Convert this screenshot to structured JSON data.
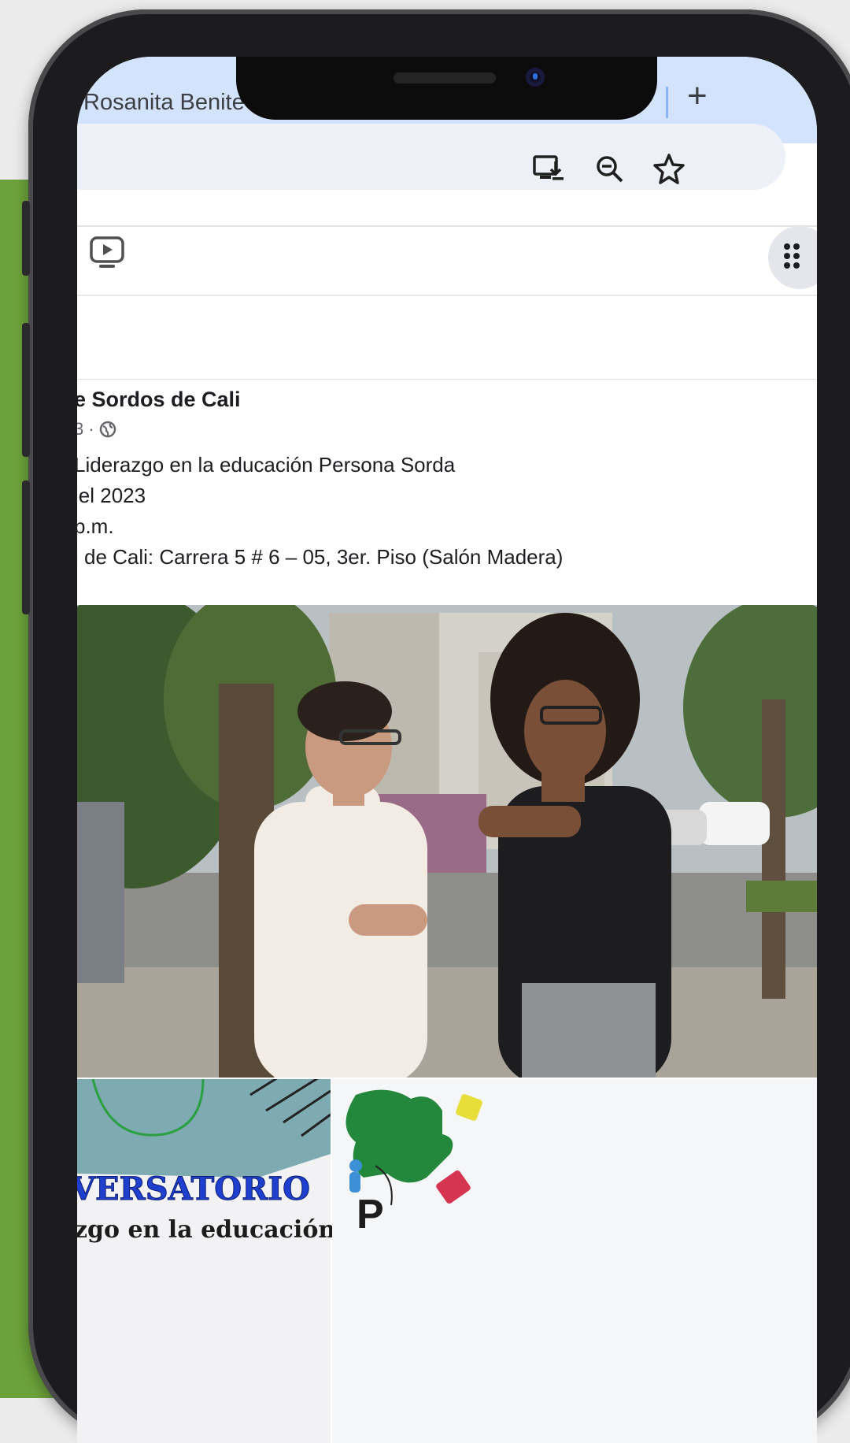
{
  "browser": {
    "tab_title": "Rosanita Benite",
    "new_tab": "+",
    "toolbar_icons": [
      "install-app-icon",
      "zoom-out-icon",
      "bookmark-star-icon"
    ]
  },
  "facebook_nav": {
    "icons": [
      "video-icon",
      "menu-grid-icon"
    ]
  },
  "post": {
    "author": "e Sordos de Cali",
    "meta": "3 ·",
    "lines": [
      "Liderazgo en la educación Persona Sorda",
      "lel 2023",
      "p.m.",
      "l de Cali: Carrera 5 # 6 – 05, 3er. Piso (Salón Madera)"
    ]
  },
  "thumbnail_left": {
    "title": "VERSATORIO",
    "subtitle": "zgo en la educación"
  },
  "thumbnail_right": {
    "letter": "P"
  },
  "colors": {
    "page_bg": "#ebebeb",
    "green_panel": "#6ca23a",
    "tab_strip": "#d3e3fd",
    "omnibox": "#edf0f6",
    "conversatorio_text": "#1f3fcf"
  }
}
